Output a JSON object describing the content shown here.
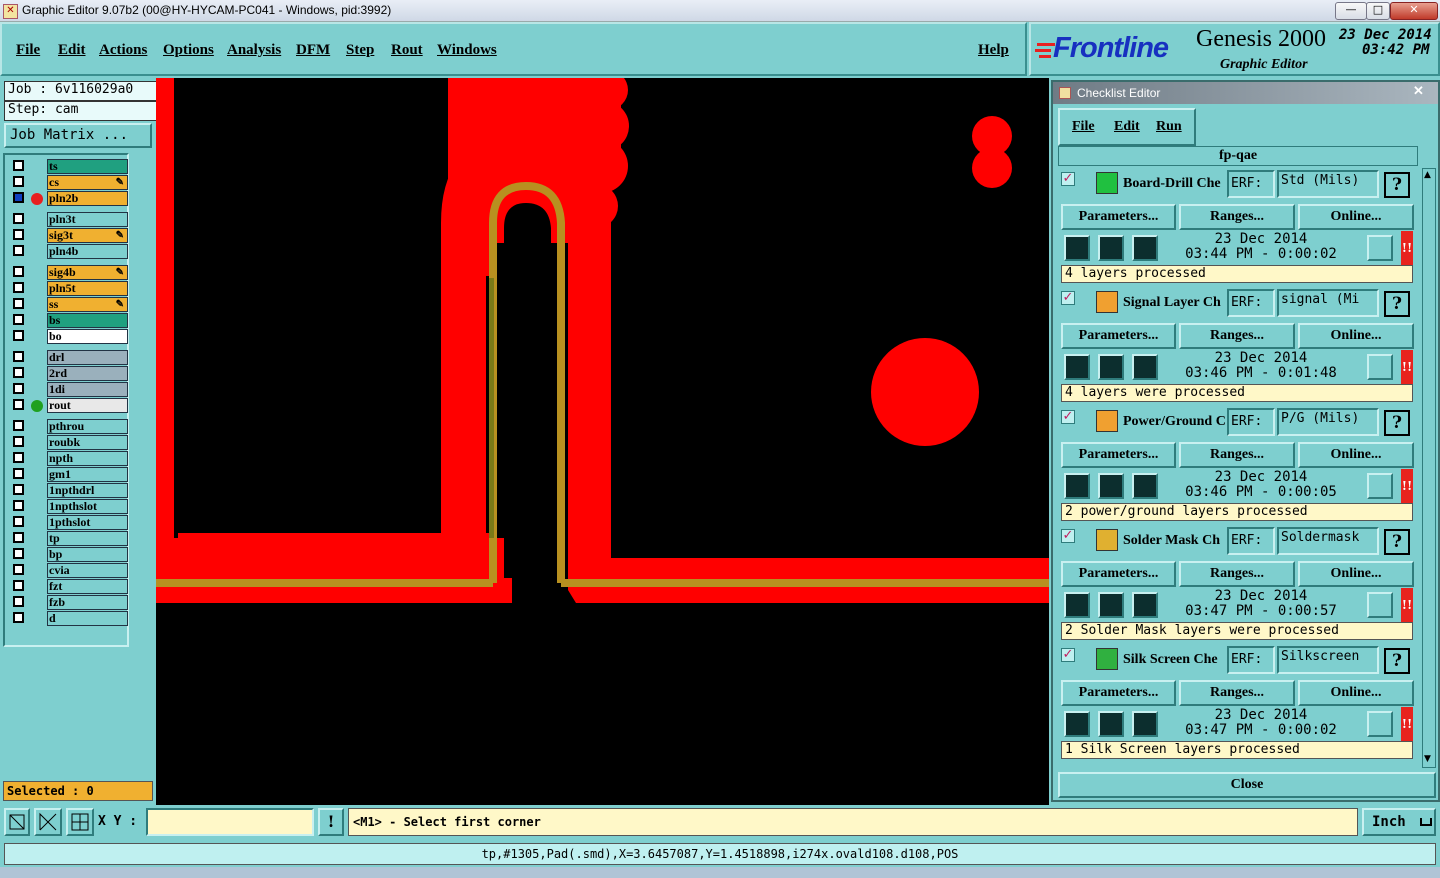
{
  "window": {
    "title": "Graphic Editor 9.07b2 (00@HY-HYCAM-PC041 - Windows, pid:3992)",
    "controls": {
      "minimize": "—",
      "maximize": "□",
      "close": "✕"
    }
  },
  "menu": {
    "items": [
      "File",
      "Edit",
      "Actions",
      "Options",
      "Analysis",
      "DFM",
      "Step",
      "Rout",
      "Windows"
    ],
    "help": "Help"
  },
  "branding": {
    "logo": "Frontline",
    "product": "Genesis 2000",
    "subtitle": "Graphic Editor",
    "date": "23 Dec 2014",
    "time": "03:42 PM"
  },
  "job": {
    "job_label": "Job : 6v116029a0",
    "step_label": "Step: cam",
    "matrix_button": "Job Matrix ..."
  },
  "layers": [
    {
      "name": "ts",
      "color": "#20a080",
      "edit": false,
      "dot": ""
    },
    {
      "name": "cs",
      "color": "#f0b030",
      "edit": true,
      "dot": ""
    },
    {
      "name": "pln2b",
      "color": "#f0b030",
      "edit": false,
      "dot": "#e82020",
      "active": true
    },
    {
      "name": "pln3t",
      "color": "#7ecfcf",
      "edit": false,
      "dot": ""
    },
    {
      "name": "sig3t",
      "color": "#f0b030",
      "edit": true,
      "dot": ""
    },
    {
      "name": "pln4b",
      "color": "#7ecfcf",
      "edit": false,
      "dot": ""
    },
    {
      "name": "sig4b",
      "color": "#f0b030",
      "edit": true,
      "dot": ""
    },
    {
      "name": "pln5t",
      "color": "#f0b030",
      "edit": false,
      "dot": ""
    },
    {
      "name": "ss",
      "color": "#f0b030",
      "edit": true,
      "dot": ""
    },
    {
      "name": "bs",
      "color": "#20a080",
      "edit": false,
      "dot": ""
    },
    {
      "name": "bo",
      "color": "#ffffff",
      "edit": false,
      "dot": ""
    },
    {
      "name": "drl",
      "color": "#9ab0bc",
      "edit": false,
      "dot": ""
    },
    {
      "name": "2rd",
      "color": "#9ab0bc",
      "edit": false,
      "dot": ""
    },
    {
      "name": "1di",
      "color": "#9ab0bc",
      "edit": false,
      "dot": ""
    },
    {
      "name": "rout",
      "color": "#e8e8e8",
      "edit": false,
      "dot": "#20a020"
    },
    {
      "name": "pthrou",
      "color": "#7ecfcf",
      "edit": false,
      "dot": ""
    },
    {
      "name": "roubk",
      "color": "#7ecfcf",
      "edit": false,
      "dot": ""
    },
    {
      "name": "npth",
      "color": "#7ecfcf",
      "edit": false,
      "dot": ""
    },
    {
      "name": "gm1",
      "color": "#7ecfcf",
      "edit": false,
      "dot": ""
    },
    {
      "name": "1npthdrl",
      "color": "#7ecfcf",
      "edit": false,
      "dot": ""
    },
    {
      "name": "1npthslot",
      "color": "#7ecfcf",
      "edit": false,
      "dot": ""
    },
    {
      "name": "1pthslot",
      "color": "#7ecfcf",
      "edit": false,
      "dot": ""
    },
    {
      "name": "tp",
      "color": "#7ecfcf",
      "edit": false,
      "dot": ""
    },
    {
      "name": "bp",
      "color": "#7ecfcf",
      "edit": false,
      "dot": ""
    },
    {
      "name": "cvia",
      "color": "#7ecfcf",
      "edit": false,
      "dot": ""
    },
    {
      "name": "fzt",
      "color": "#7ecfcf",
      "edit": false,
      "dot": ""
    },
    {
      "name": "fzb",
      "color": "#7ecfcf",
      "edit": false,
      "dot": ""
    },
    {
      "name": "d",
      "color": "#7ecfcf",
      "edit": false,
      "dot": ""
    }
  ],
  "selected": "Selected : 0",
  "checklist": {
    "title": "Checklist Editor",
    "menu": [
      "File",
      "Edit",
      "Run"
    ],
    "name": "fp-qae",
    "erf_label": "ERF:",
    "buttons": {
      "parameters": "Parameters...",
      "ranges": "Ranges...",
      "online": "Online..."
    },
    "entries": [
      {
        "name": "Board-Drill Che",
        "erf": "Std (Mils)",
        "date": "23 Dec 2014",
        "time": "03:44 PM - 0:00:02",
        "result": "4 layers processed",
        "icon_color": "#20c040"
      },
      {
        "name": "Signal Layer Ch",
        "erf": "signal (Mi",
        "date": "23 Dec 2014",
        "time": "03:46 PM - 0:01:48",
        "result": "4 layers were processed",
        "icon_color": "#f0a030"
      },
      {
        "name": "Power/Ground C",
        "erf": "P/G (Mils)",
        "date": "23 Dec 2014",
        "time": "03:46 PM - 0:00:05",
        "result": "2 power/ground layers processed",
        "icon_color": "#f0a030"
      },
      {
        "name": "Solder Mask Ch",
        "erf": "Soldermask",
        "date": "23 Dec 2014",
        "time": "03:47 PM - 0:00:57",
        "result": "2 Solder Mask layers were processed",
        "icon_color": "#e0b030"
      },
      {
        "name": "Silk Screen Che",
        "erf": "Silkscreen",
        "date": "23 Dec 2014",
        "time": "03:47 PM - 0:00:02",
        "result": "1 Silk Screen layers processed",
        "icon_color": "#30b040"
      }
    ],
    "close": "Close"
  },
  "bottom": {
    "xy_label": "X Y :",
    "xy_value": "",
    "alert": "!",
    "prompt": "<M1> - Select first corner",
    "units": "Inch"
  },
  "status": "tp,#1305,Pad(.smd),X=3.6457087,Y=1.4518898,i274x.ovald108.d108,POS"
}
